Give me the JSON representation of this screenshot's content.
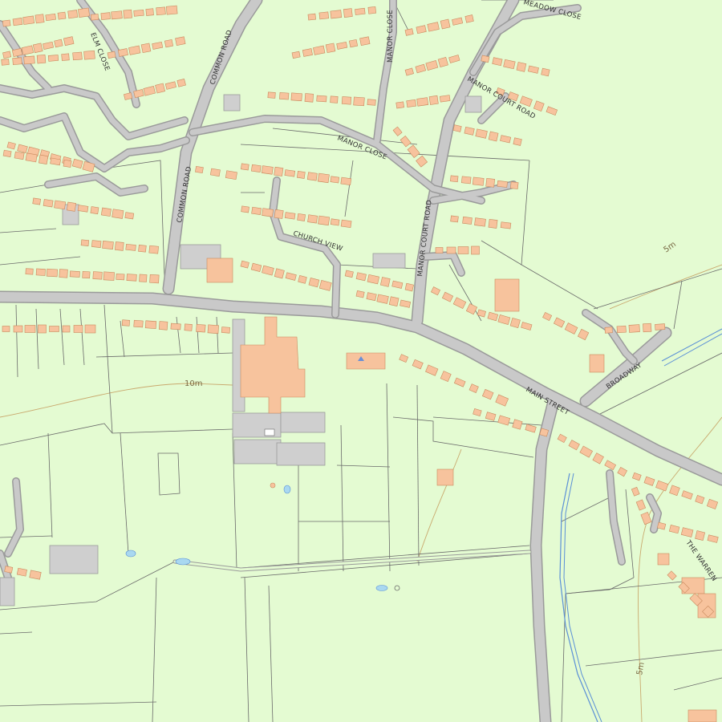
{
  "map": {
    "colors": {
      "land": "#e4fbd2",
      "road": "#c9c9c9",
      "road_edge": "#9a9a9a",
      "building": "#f7c39d",
      "building_edge": "#c98a5e",
      "parcel_line": "#6a6a6a",
      "water": "#a9d8f0",
      "water_line": "#5a8fd6",
      "contour": "#c9a96e",
      "grey_block": "#cfcfcf"
    },
    "road_labels": {
      "common_road_north": "COMMON ROAD",
      "common_road_south": "COMMON ROAD",
      "elm_close": "ELM CLOSE",
      "manor_close_north": "MANOR CLOSE",
      "manor_close": "MANOR CLOSE",
      "meadow_close": "MEADOW CLOSE",
      "manor_court_road_north": "MANOR COURT ROAD",
      "manor_court_road": "MANOR COURT ROAD",
      "church_view": "CHURCH VIEW",
      "main_street": "MAIN STREET",
      "broadway": "BROADWAY",
      "the_warren": "THE WARREN"
    },
    "contour_labels": {
      "ten_m": "10m",
      "five_m_east": "5m",
      "five_m_south": "5m"
    }
  }
}
